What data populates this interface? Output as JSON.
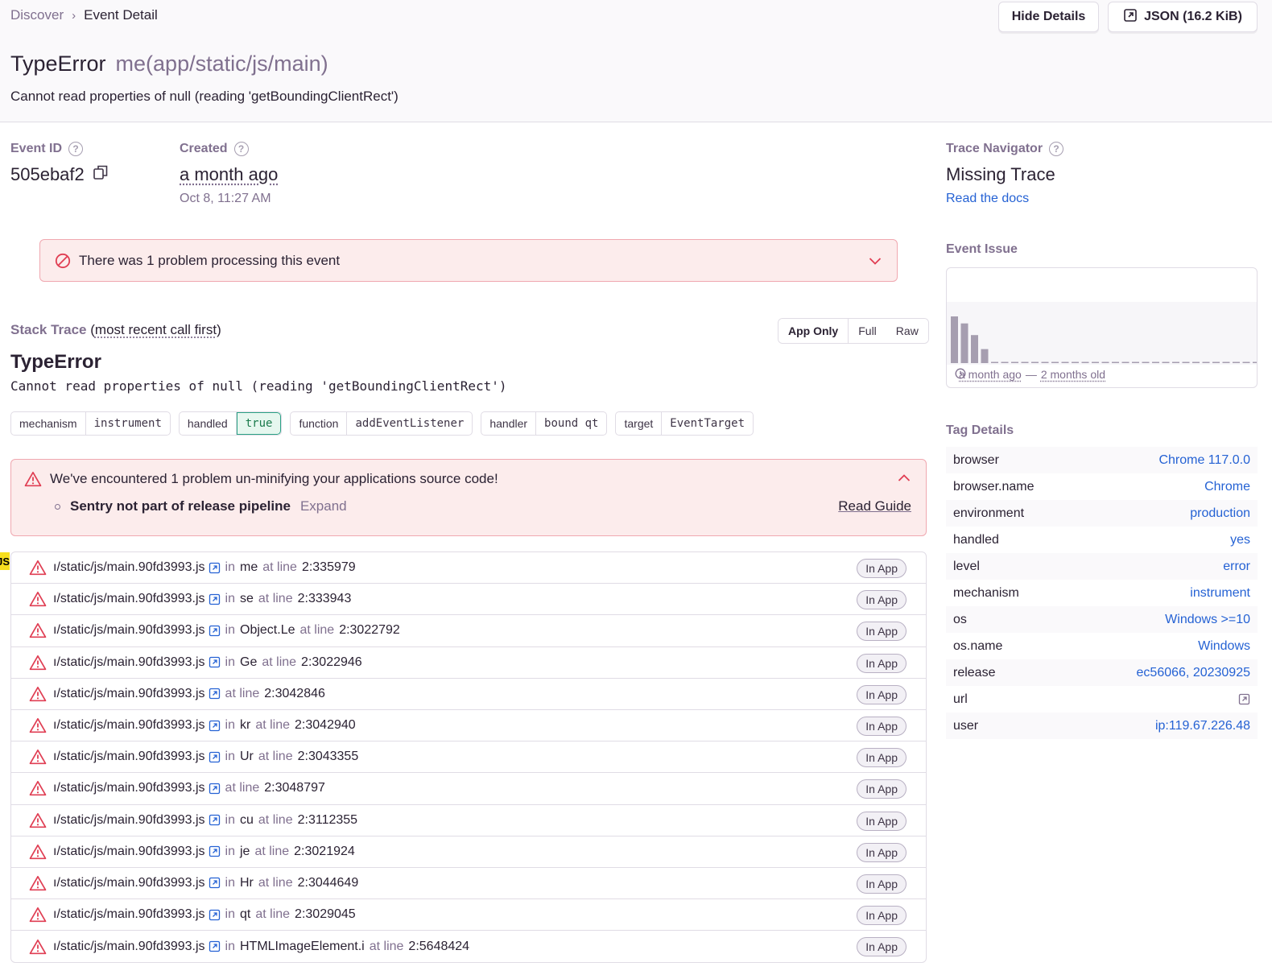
{
  "breadcrumb": {
    "parent": "Discover",
    "current": "Event Detail"
  },
  "header_actions": {
    "hide_details": "Hide Details",
    "json": "JSON (16.2 KiB)"
  },
  "title": {
    "type": "TypeError",
    "culprit": "me(app/static/js/main)",
    "message": "Cannot read properties of null (reading 'getBoundingClientRect')"
  },
  "meta": {
    "event_id_label": "Event ID",
    "event_id": "505ebaf2",
    "created_label": "Created",
    "created_relative": "a month ago",
    "created_absolute": "Oct 8, 11:27 AM"
  },
  "processing_alert": {
    "text": "There was 1 problem processing this event"
  },
  "stack_trace": {
    "label": "Stack Trace",
    "order_text": "most recent call first",
    "views": [
      "App Only",
      "Full",
      "Raw"
    ],
    "active_view": "App Only",
    "exception_type": "TypeError",
    "exception_value": "Cannot read properties of null (reading 'getBoundingClientRect')",
    "mechanism": [
      {
        "key": "mechanism",
        "value": "instrument"
      },
      {
        "key": "handled",
        "value": "true"
      },
      {
        "key": "function",
        "value": "addEventListener"
      },
      {
        "key": "handler",
        "value": "bound qt"
      },
      {
        "key": "target",
        "value": "EventTarget"
      }
    ],
    "sourcemap_alert": {
      "title": "We've encountered 1 problem un-minifying your applications source code!",
      "item": "Sentry not part of release pipeline",
      "expand": "Expand",
      "guide": "Read Guide"
    },
    "js_badge": "JS",
    "frame_file": "ı/static/js/main.90fd3993.js",
    "in_label": "in",
    "at_line_label": "at line",
    "in_app_label": "In App",
    "frames": [
      {
        "fn": "me",
        "line": "2:335979"
      },
      {
        "fn": "se",
        "line": "2:333943"
      },
      {
        "fn": "Object.Le",
        "line": "2:3022792"
      },
      {
        "fn": "Ge",
        "line": "2:3022946"
      },
      {
        "fn": "",
        "line": "2:3042846"
      },
      {
        "fn": "kr",
        "line": "2:3042940"
      },
      {
        "fn": "Ur",
        "line": "2:3043355"
      },
      {
        "fn": "",
        "line": "2:3048797"
      },
      {
        "fn": "cu",
        "line": "2:3112355"
      },
      {
        "fn": "je",
        "line": "2:3021924"
      },
      {
        "fn": "Hr",
        "line": "2:3044649"
      },
      {
        "fn": "qt",
        "line": "2:3029045"
      },
      {
        "fn": "HTMLImageElement.i",
        "line": "2:5648424"
      }
    ]
  },
  "trace_navigator": {
    "label": "Trace Navigator",
    "value": "Missing Trace",
    "link": "Read the docs"
  },
  "event_issue": {
    "label": "Event Issue",
    "first_seen": "a month ago",
    "separator": "—",
    "age": "2 months old",
    "bars": [
      1.0,
      0.85,
      0.6,
      0.3,
      0.02,
      0.02,
      0.02,
      0.02,
      0.02,
      0.02,
      0.02,
      0.02,
      0.02,
      0.02,
      0.02,
      0.02,
      0.02,
      0.02,
      0.02,
      0.02,
      0.02,
      0.02,
      0.02,
      0.02,
      0.02,
      0.02,
      0.02,
      0.02,
      0.02,
      0.02,
      0.02
    ],
    "bar_color": "#a69eb0"
  },
  "tag_details": {
    "label": "Tag Details",
    "rows": [
      {
        "key": "browser",
        "value": "Chrome 117.0.0"
      },
      {
        "key": "browser.name",
        "value": "Chrome"
      },
      {
        "key": "environment",
        "value": "production"
      },
      {
        "key": "handled",
        "value": "yes"
      },
      {
        "key": "level",
        "value": "error"
      },
      {
        "key": "mechanism",
        "value": "instrument"
      },
      {
        "key": "os",
        "value": "Windows >=10"
      },
      {
        "key": "os.name",
        "value": "Windows"
      },
      {
        "key": "release",
        "value": "ec56066, 20230925"
      },
      {
        "key": "url",
        "value": ""
      },
      {
        "key": "user",
        "value": "ip:119.67.226.48"
      }
    ]
  },
  "colors": {
    "link": "#2562d4",
    "error": "#e03e53",
    "muted": "#80708f",
    "alert_bg": "#fcecec"
  }
}
